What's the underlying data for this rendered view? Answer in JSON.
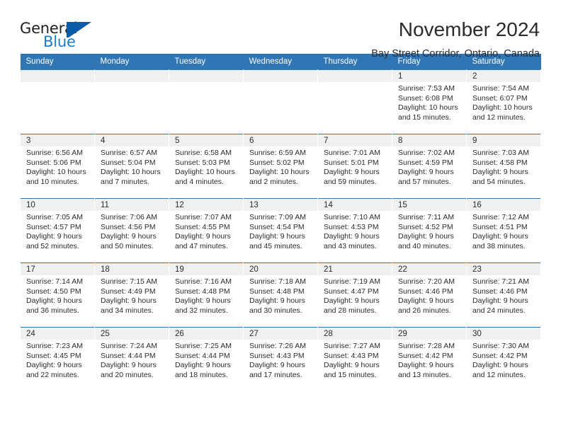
{
  "brand": {
    "name_part1": "General",
    "name_part2": "Blue",
    "logo_icon": "triangle-logo-icon",
    "accent_dark": "#0a5ca8",
    "accent_light": "#1d7cc4"
  },
  "header": {
    "month_title": "November 2024",
    "location": "Bay Street Corridor, Ontario, Canada"
  },
  "theme": {
    "header_blue": "#3075b4",
    "daynum_strip_gray": "#f0f0f0",
    "text": "#2b2b2b"
  },
  "weekdays": [
    "Sunday",
    "Monday",
    "Tuesday",
    "Wednesday",
    "Thursday",
    "Friday",
    "Saturday"
  ],
  "labels": {
    "sunrise_prefix": "Sunrise:",
    "sunset_prefix": "Sunset:",
    "daylight_prefix": "Daylight:"
  },
  "weeks": [
    [
      {
        "day": "",
        "sunrise": "",
        "sunset": "",
        "daylight_line1": "",
        "daylight_line2": ""
      },
      {
        "day": "",
        "sunrise": "",
        "sunset": "",
        "daylight_line1": "",
        "daylight_line2": ""
      },
      {
        "day": "",
        "sunrise": "",
        "sunset": "",
        "daylight_line1": "",
        "daylight_line2": ""
      },
      {
        "day": "",
        "sunrise": "",
        "sunset": "",
        "daylight_line1": "",
        "daylight_line2": ""
      },
      {
        "day": "",
        "sunrise": "",
        "sunset": "",
        "daylight_line1": "",
        "daylight_line2": ""
      },
      {
        "day": "1",
        "sunrise": "Sunrise: 7:53 AM",
        "sunset": "Sunset: 6:08 PM",
        "daylight_line1": "Daylight: 10 hours",
        "daylight_line2": "and 15 minutes."
      },
      {
        "day": "2",
        "sunrise": "Sunrise: 7:54 AM",
        "sunset": "Sunset: 6:07 PM",
        "daylight_line1": "Daylight: 10 hours",
        "daylight_line2": "and 12 minutes."
      }
    ],
    [
      {
        "day": "3",
        "sunrise": "Sunrise: 6:56 AM",
        "sunset": "Sunset: 5:06 PM",
        "daylight_line1": "Daylight: 10 hours",
        "daylight_line2": "and 10 minutes."
      },
      {
        "day": "4",
        "sunrise": "Sunrise: 6:57 AM",
        "sunset": "Sunset: 5:04 PM",
        "daylight_line1": "Daylight: 10 hours",
        "daylight_line2": "and 7 minutes."
      },
      {
        "day": "5",
        "sunrise": "Sunrise: 6:58 AM",
        "sunset": "Sunset: 5:03 PM",
        "daylight_line1": "Daylight: 10 hours",
        "daylight_line2": "and 4 minutes."
      },
      {
        "day": "6",
        "sunrise": "Sunrise: 6:59 AM",
        "sunset": "Sunset: 5:02 PM",
        "daylight_line1": "Daylight: 10 hours",
        "daylight_line2": "and 2 minutes."
      },
      {
        "day": "7",
        "sunrise": "Sunrise: 7:01 AM",
        "sunset": "Sunset: 5:01 PM",
        "daylight_line1": "Daylight: 9 hours",
        "daylight_line2": "and 59 minutes."
      },
      {
        "day": "8",
        "sunrise": "Sunrise: 7:02 AM",
        "sunset": "Sunset: 4:59 PM",
        "daylight_line1": "Daylight: 9 hours",
        "daylight_line2": "and 57 minutes."
      },
      {
        "day": "9",
        "sunrise": "Sunrise: 7:03 AM",
        "sunset": "Sunset: 4:58 PM",
        "daylight_line1": "Daylight: 9 hours",
        "daylight_line2": "and 54 minutes."
      }
    ],
    [
      {
        "day": "10",
        "sunrise": "Sunrise: 7:05 AM",
        "sunset": "Sunset: 4:57 PM",
        "daylight_line1": "Daylight: 9 hours",
        "daylight_line2": "and 52 minutes."
      },
      {
        "day": "11",
        "sunrise": "Sunrise: 7:06 AM",
        "sunset": "Sunset: 4:56 PM",
        "daylight_line1": "Daylight: 9 hours",
        "daylight_line2": "and 50 minutes."
      },
      {
        "day": "12",
        "sunrise": "Sunrise: 7:07 AM",
        "sunset": "Sunset: 4:55 PM",
        "daylight_line1": "Daylight: 9 hours",
        "daylight_line2": "and 47 minutes."
      },
      {
        "day": "13",
        "sunrise": "Sunrise: 7:09 AM",
        "sunset": "Sunset: 4:54 PM",
        "daylight_line1": "Daylight: 9 hours",
        "daylight_line2": "and 45 minutes."
      },
      {
        "day": "14",
        "sunrise": "Sunrise: 7:10 AM",
        "sunset": "Sunset: 4:53 PM",
        "daylight_line1": "Daylight: 9 hours",
        "daylight_line2": "and 43 minutes."
      },
      {
        "day": "15",
        "sunrise": "Sunrise: 7:11 AM",
        "sunset": "Sunset: 4:52 PM",
        "daylight_line1": "Daylight: 9 hours",
        "daylight_line2": "and 40 minutes."
      },
      {
        "day": "16",
        "sunrise": "Sunrise: 7:12 AM",
        "sunset": "Sunset: 4:51 PM",
        "daylight_line1": "Daylight: 9 hours",
        "daylight_line2": "and 38 minutes."
      }
    ],
    [
      {
        "day": "17",
        "sunrise": "Sunrise: 7:14 AM",
        "sunset": "Sunset: 4:50 PM",
        "daylight_line1": "Daylight: 9 hours",
        "daylight_line2": "and 36 minutes."
      },
      {
        "day": "18",
        "sunrise": "Sunrise: 7:15 AM",
        "sunset": "Sunset: 4:49 PM",
        "daylight_line1": "Daylight: 9 hours",
        "daylight_line2": "and 34 minutes."
      },
      {
        "day": "19",
        "sunrise": "Sunrise: 7:16 AM",
        "sunset": "Sunset: 4:48 PM",
        "daylight_line1": "Daylight: 9 hours",
        "daylight_line2": "and 32 minutes."
      },
      {
        "day": "20",
        "sunrise": "Sunrise: 7:18 AM",
        "sunset": "Sunset: 4:48 PM",
        "daylight_line1": "Daylight: 9 hours",
        "daylight_line2": "and 30 minutes."
      },
      {
        "day": "21",
        "sunrise": "Sunrise: 7:19 AM",
        "sunset": "Sunset: 4:47 PM",
        "daylight_line1": "Daylight: 9 hours",
        "daylight_line2": "and 28 minutes."
      },
      {
        "day": "22",
        "sunrise": "Sunrise: 7:20 AM",
        "sunset": "Sunset: 4:46 PM",
        "daylight_line1": "Daylight: 9 hours",
        "daylight_line2": "and 26 minutes."
      },
      {
        "day": "23",
        "sunrise": "Sunrise: 7:21 AM",
        "sunset": "Sunset: 4:46 PM",
        "daylight_line1": "Daylight: 9 hours",
        "daylight_line2": "and 24 minutes."
      }
    ],
    [
      {
        "day": "24",
        "sunrise": "Sunrise: 7:23 AM",
        "sunset": "Sunset: 4:45 PM",
        "daylight_line1": "Daylight: 9 hours",
        "daylight_line2": "and 22 minutes."
      },
      {
        "day": "25",
        "sunrise": "Sunrise: 7:24 AM",
        "sunset": "Sunset: 4:44 PM",
        "daylight_line1": "Daylight: 9 hours",
        "daylight_line2": "and 20 minutes."
      },
      {
        "day": "26",
        "sunrise": "Sunrise: 7:25 AM",
        "sunset": "Sunset: 4:44 PM",
        "daylight_line1": "Daylight: 9 hours",
        "daylight_line2": "and 18 minutes."
      },
      {
        "day": "27",
        "sunrise": "Sunrise: 7:26 AM",
        "sunset": "Sunset: 4:43 PM",
        "daylight_line1": "Daylight: 9 hours",
        "daylight_line2": "and 17 minutes."
      },
      {
        "day": "28",
        "sunrise": "Sunrise: 7:27 AM",
        "sunset": "Sunset: 4:43 PM",
        "daylight_line1": "Daylight: 9 hours",
        "daylight_line2": "and 15 minutes."
      },
      {
        "day": "29",
        "sunrise": "Sunrise: 7:28 AM",
        "sunset": "Sunset: 4:42 PM",
        "daylight_line1": "Daylight: 9 hours",
        "daylight_line2": "and 13 minutes."
      },
      {
        "day": "30",
        "sunrise": "Sunrise: 7:30 AM",
        "sunset": "Sunset: 4:42 PM",
        "daylight_line1": "Daylight: 9 hours",
        "daylight_line2": "and 12 minutes."
      }
    ]
  ]
}
